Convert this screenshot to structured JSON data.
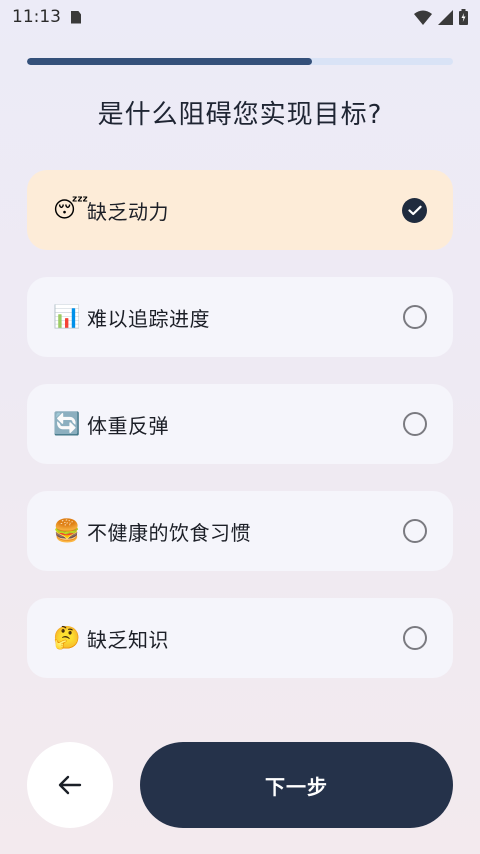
{
  "status_bar": {
    "time": "11:13"
  },
  "progress": {
    "fraction": 0.67,
    "color": "#34507a"
  },
  "title": "是什么阻碍您实现目标?",
  "options": [
    {
      "emoji": "😴",
      "label": "缺乏动力",
      "selected": true
    },
    {
      "emoji": "📊",
      "label": "难以追踪进度",
      "selected": false
    },
    {
      "emoji": "🔄",
      "label": "体重反弹",
      "selected": false
    },
    {
      "emoji": "🍔",
      "label": "不健康的饮食习惯",
      "selected": false
    },
    {
      "emoji": "🤔",
      "label": "缺乏知识",
      "selected": false
    }
  ],
  "buttons": {
    "back_icon": "arrow-left-icon",
    "next_label": "下一步"
  },
  "colors": {
    "selected_bg": "#fdecd8",
    "option_bg": "#f5f5fb",
    "primary": "#25324a"
  }
}
